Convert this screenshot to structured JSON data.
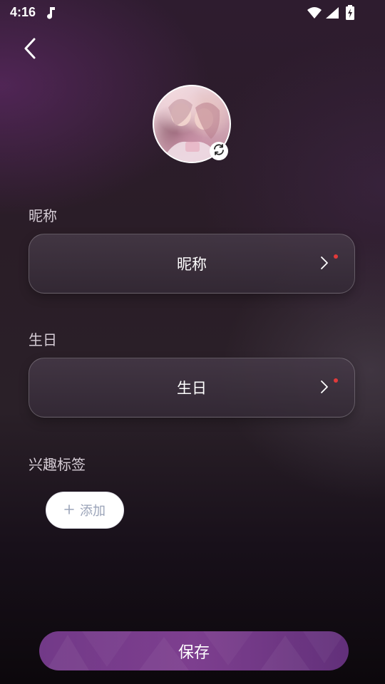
{
  "status_bar": {
    "time": "4:16",
    "icons": [
      "music-note-icon",
      "wifi-icon",
      "signal-icon",
      "battery-charging-icon"
    ]
  },
  "header": {
    "back_icon": "chevron-left-icon"
  },
  "avatar": {
    "badge_icon": "refresh-icon"
  },
  "nickname": {
    "label": "昵称",
    "value": "昵称"
  },
  "birthday": {
    "label": "生日",
    "value": "生日"
  },
  "interests": {
    "label": "兴趣标签",
    "add_label": "添加",
    "add_icon": "plus-icon"
  },
  "footer": {
    "save_label": "保存"
  },
  "colors": {
    "accent": "#6b2f82",
    "dot": "#e23a3a"
  }
}
